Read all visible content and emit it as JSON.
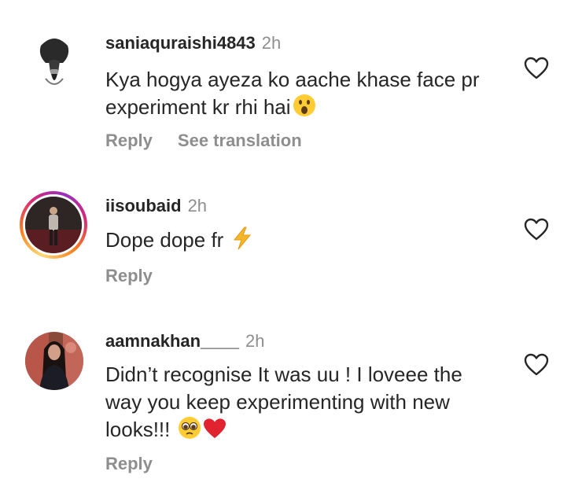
{
  "comments": [
    {
      "username": "saniaquraishi4843",
      "time": "2h",
      "text": "Kya hogya ayeza ko aache khase face pr experiment kr rhi hai",
      "emoji": "astonished-face-icon",
      "reply_label": "Reply",
      "translate_label": "See translation",
      "has_story_ring": false
    },
    {
      "username": "iisoubaid",
      "time": "2h",
      "text": "Dope dope fr",
      "emoji": "lightning-icon",
      "reply_label": "Reply",
      "has_story_ring": true
    },
    {
      "username": "aamnakhan____",
      "time": "2h",
      "text": "Didn’t recognise It was uu ! I loveee the way you keep experimenting with new looks!!!",
      "emoji": "pleading-face-icon, red-heart-icon",
      "reply_label": "Reply",
      "has_story_ring": false
    }
  ],
  "colors": {
    "text": "#262626",
    "secondary": "#8e8e8e",
    "background": "#ffffff"
  }
}
